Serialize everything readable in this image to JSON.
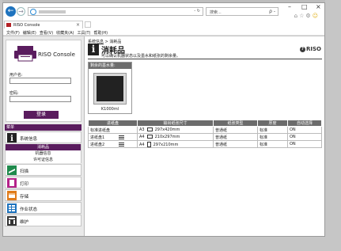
{
  "browser": {
    "address_suffix": "- ↻",
    "search_placeholder": "搜索...",
    "search_icon": "ρ -",
    "min_label": "–",
    "max_label": "□",
    "close_label": "×",
    "tab_title": "RISO Console",
    "tab_close": "×",
    "menu": [
      "文件(F)",
      "编辑(E)",
      "查看(V)",
      "收藏夹(A)",
      "工具(T)",
      "帮助(H)"
    ],
    "icons": [
      "home-icon",
      "star-icon",
      "gear-icon",
      "smiley-icon"
    ]
  },
  "sidebar": {
    "logo_text": "RISO Console",
    "username_label": "用户名:",
    "password_label": "密码:",
    "login_button": "登录",
    "section_header": "菜单",
    "items": [
      {
        "label": "系统信息",
        "icon": "info-icon"
      },
      {
        "label": "扫描",
        "icon": "scan-icon"
      },
      {
        "label": "打印",
        "icon": "print-icon"
      },
      {
        "label": "存储",
        "icon": "storage-icon"
      },
      {
        "label": "作业状态",
        "icon": "job-status-icon"
      },
      {
        "label": "维护",
        "icon": "maintenance-icon"
      }
    ],
    "sub_items": [
      "消耗品",
      "机器信息",
      "许可证信息"
    ]
  },
  "main": {
    "breadcrumb_link": "系统信息",
    "breadcrumb_sep": " > ",
    "breadcrumb_current": "消耗品",
    "title": "消耗品",
    "subtitle": "可以确认机器状态以及墨水和纸张的剩余量。",
    "brand": "RISO",
    "ink_header": "剩余的墨水量:",
    "ink_name": "K1000ml",
    "table_headers": [
      "进纸盘",
      "输出纸张尺寸",
      "纸张类型",
      "厚度",
      "自动选择"
    ],
    "rows": [
      {
        "tray": "标准进纸盘",
        "size_code": "A3",
        "size": "297x420mm",
        "type": "普通纸",
        "thickness": "标准",
        "auto": "ON",
        "orient": "landscape",
        "has_icon": false
      },
      {
        "tray": "进纸盘1",
        "size_code": "A4",
        "size": "210x297mm",
        "type": "普通纸",
        "thickness": "标准",
        "auto": "ON",
        "orient": "landscape",
        "has_icon": true
      },
      {
        "tray": "进纸盘2",
        "size_code": "A4",
        "size": "297x210mm",
        "type": "普通纸",
        "thickness": "标准",
        "auto": "ON",
        "orient": "portrait",
        "has_icon": true
      }
    ]
  },
  "colors": {
    "accent": "#5a1c5e",
    "header_gray": "#6c6c6c"
  }
}
